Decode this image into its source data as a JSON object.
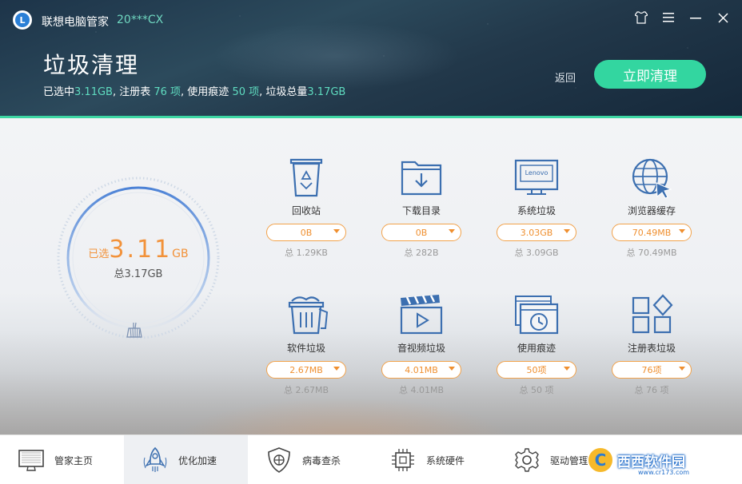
{
  "app": {
    "name": "联想电脑管家",
    "user": "20***CX",
    "logo_letter": "L"
  },
  "window_controls": [
    {
      "name": "skin-icon",
      "glyph": "⛉"
    },
    {
      "name": "menu-icon",
      "glyph": "☰"
    },
    {
      "name": "minimize-icon",
      "glyph": "—"
    },
    {
      "name": "close-icon",
      "glyph": "✕"
    }
  ],
  "header": {
    "title": "垃圾清理",
    "summary": {
      "p1": "已选中",
      "selected": "3.11GB",
      "p2": ", 注册表 ",
      "registry": "76 项",
      "p3": ", 使用痕迹 ",
      "traces": "50 项",
      "p4": ", 垃圾总量",
      "total": "3.17GB"
    },
    "back_label": "返回",
    "clean_button": "立即清理"
  },
  "gauge": {
    "selected_label": "已选",
    "selected_value": "3.11",
    "selected_unit": "GB",
    "total_label": "总3.17GB",
    "fraction": 0.98
  },
  "items": [
    {
      "label": "回收站",
      "value": "0B",
      "total": "总 1.29KB",
      "icon": "recycle-bin-icon"
    },
    {
      "label": "下载目录",
      "value": "0B",
      "total": "总 282B",
      "icon": "download-folder-icon"
    },
    {
      "label": "系统垃圾",
      "value": "3.03GB",
      "total": "总 3.09GB",
      "icon": "lenovo-monitor-icon",
      "brand": "Lenovo"
    },
    {
      "label": "浏览器缓存",
      "value": "70.49MB",
      "total": "总 70.49MB",
      "icon": "browser-globe-icon"
    },
    {
      "label": "软件垃圾",
      "value": "2.67MB",
      "total": "总 2.67MB",
      "icon": "software-trash-icon"
    },
    {
      "label": "音视频垃圾",
      "value": "4.01MB",
      "total": "总 4.01MB",
      "icon": "video-clapper-icon"
    },
    {
      "label": "使用痕迹",
      "value": "50项",
      "total": "总 50 项",
      "icon": "usage-history-icon"
    },
    {
      "label": "注册表垃圾",
      "value": "76项",
      "total": "总 76 项",
      "icon": "registry-blocks-icon"
    }
  ],
  "nav": [
    {
      "label": "管家主页",
      "icon": "monitor-icon"
    },
    {
      "label": "优化加速",
      "icon": "rocket-icon",
      "active": true
    },
    {
      "label": "病毒查杀",
      "icon": "shield-icon"
    },
    {
      "label": "系统硬件",
      "icon": "chip-icon"
    },
    {
      "label": "驱动管理",
      "icon": "gear-icon"
    }
  ],
  "watermark": {
    "badge": "C",
    "text": "西西软件园",
    "sub": "www.cr173.com"
  },
  "colors": {
    "accent_green": "#33d6a0",
    "highlight_teal": "#5fdcc0",
    "orange": "#ef8f2f",
    "icon_blue": "#3c6fb0",
    "gauge_blue": "#4c82d6"
  }
}
